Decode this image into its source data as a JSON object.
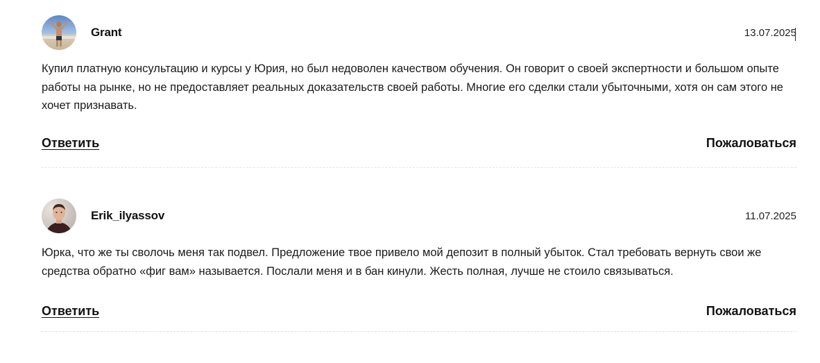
{
  "comments": [
    {
      "author": "Grant",
      "date": "13.07.2025",
      "text": "Купил платную консультацию и курсы у Юрия, но был недоволен качеством обучения. Он говорит о своей экспертности и большом опыте работы на рынке, но не предоставляет реальных доказательств своей работы. Многие его сделки стали убыточными, хотя он сам этого не хочет признавать.",
      "reply_label": "Ответить",
      "report_label": "Пожаловаться"
    },
    {
      "author": "Erik_ilyassov",
      "date": "11.07.2025",
      "text": "Юрка, что же ты сволочь меня так подвел. Предложение твое привело мой депозит в полный убыток. Стал требовать вернуть свои же средства обратно «фиг вам» называется. Послали меня и в бан кинули. Жесть полная, лучше не стоило связываться.",
      "reply_label": "Ответить",
      "report_label": "Пожаловаться"
    }
  ]
}
